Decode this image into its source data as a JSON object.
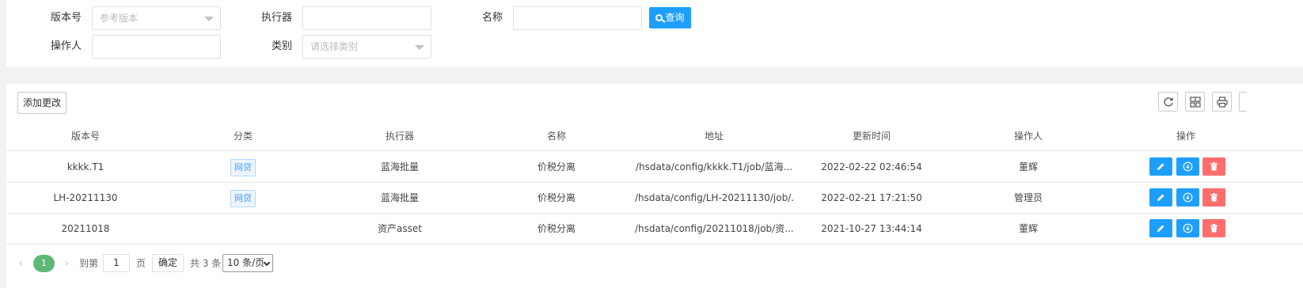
{
  "search": {
    "version_label": "版本号",
    "version_placeholder": "参考版本",
    "executor_label": "执行器",
    "executor_value": "",
    "name_label": "名称",
    "name_value": "",
    "query_label": "查询",
    "operator_label": "操作人",
    "operator_value": "",
    "category_label": "类别",
    "category_placeholder": "请选择类别"
  },
  "toolbar": {
    "add_label": "添加更改",
    "tools": [
      "refresh-icon",
      "columns-icon",
      "print-icon"
    ]
  },
  "table": {
    "columns": [
      "版本号",
      "分类",
      "执行器",
      "名称",
      "地址",
      "更新时间",
      "操作人",
      "操作"
    ],
    "rows": [
      {
        "version": "kkkk.T1",
        "category": "网贷",
        "executor": "蓝海批量",
        "name": "价税分离",
        "address": "/hsdata/config/kkkk.T1/job/蓝海...",
        "updated": "2022-02-22 02:46:54",
        "operator": "董辉"
      },
      {
        "version": "LH-20211130",
        "category": "网贷",
        "executor": "蓝海批量",
        "name": "价税分离",
        "address": "/hsdata/config/LH-20211130/job/...",
        "updated": "2022-02-21 17:21:50",
        "operator": "管理员"
      },
      {
        "version": "20211018",
        "category": "",
        "executor": "资产asset",
        "name": "价税分离",
        "address": "/hsdata/config/20211018/job/资...",
        "updated": "2021-10-27 13:44:14",
        "operator": "董辉"
      }
    ]
  },
  "pagination": {
    "current_page": "1",
    "goto_label": "到第",
    "goto_value": "1",
    "page_suffix": "页",
    "confirm_label": "确定",
    "total_label": "共 3 条",
    "page_size": "10 条/页"
  },
  "colors": {
    "primary": "#1e9fff",
    "danger": "#ff6d6d",
    "pager_active": "#5fb878",
    "tag": "#409eff"
  }
}
